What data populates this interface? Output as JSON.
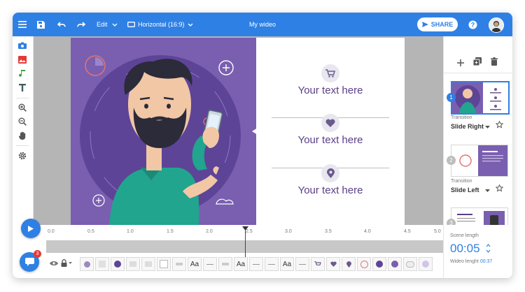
{
  "topbar": {
    "edit_label": "Edit",
    "format_label": "Horizontal (16:9)",
    "title": "My wideo",
    "share_label": "SHARE"
  },
  "slide": {
    "items": [
      {
        "icon": "cart-icon",
        "text": "Your text here"
      },
      {
        "icon": "heart-icon",
        "text": "Your text here"
      },
      {
        "icon": "location-pin-icon",
        "text": "Your text here"
      }
    ]
  },
  "scenes": [
    {
      "number": "1",
      "transition_label": "Transition",
      "transition": "Slide Right"
    },
    {
      "number": "2",
      "transition_label": "Transition",
      "transition": "Slide Left"
    },
    {
      "number": "3"
    }
  ],
  "timeline": {
    "ticks": [
      "0.0",
      "0.5",
      "1.0",
      "1.5",
      "2.0",
      "2.5",
      "3.0",
      "3.5",
      "4.0",
      "4.5",
      "5.0"
    ],
    "chip_text": "Aa"
  },
  "scene_length": {
    "label": "Scene length",
    "value": "00:05",
    "wideo_length_label": "Wideo lenght",
    "wideo_length_value": "00:37"
  },
  "chat": {
    "badge": "3"
  },
  "colors": {
    "accent": "#2f80e4",
    "purple": "#7a5fb0",
    "dark_purple": "#5a3f86"
  }
}
